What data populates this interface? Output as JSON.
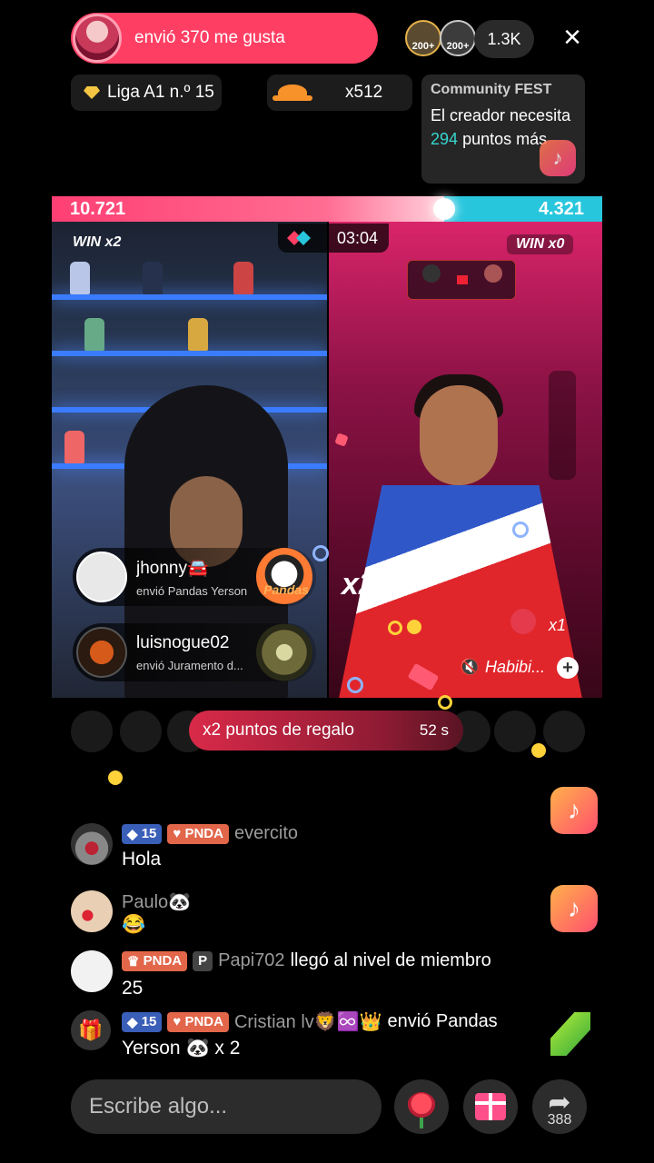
{
  "top": {
    "like_banner": "envió 370 me gusta",
    "viewer_badges": [
      "200+",
      "200+"
    ],
    "viewer_count": "1.3K",
    "close_icon": "×"
  },
  "chips": {
    "league": "Liga A1 n.º 15",
    "hat_count": "x512"
  },
  "community": {
    "title": "Community FEST",
    "line_before": "El creador necesita",
    "points": "294",
    "line_after": "puntos más"
  },
  "battle": {
    "left_score": "10.721",
    "right_score": "4.321",
    "left_share": 0.713,
    "win_left": "WIN x2",
    "win_right": "WIN x0",
    "timer": "03:04",
    "multiplier_big": "x2",
    "rose_multiplier": "x1",
    "music": "Habibi..."
  },
  "gifts": [
    {
      "user": "jhonny🚘",
      "desc": "envió Pandas Yerson",
      "gift_name": "Pandas"
    },
    {
      "user": "luisnogue02",
      "desc": "envió Juramento d..."
    }
  ],
  "bonus": {
    "label": "x2 puntos de regalo",
    "time": "52 s"
  },
  "chat": [
    {
      "level": "15",
      "badge": "PNDA",
      "name": "evercito",
      "message": "Hola"
    },
    {
      "name": "Paulo🐼",
      "message": "😂"
    },
    {
      "badge": "PNDA",
      "name": "Papi702",
      "event": "llegó al nivel de miembro",
      "value": "25"
    },
    {
      "level": "15",
      "badge": "PNDA",
      "name": "Cristian lv🦁♾️👑",
      "event": "envió Pandas",
      "line2": "Yerson 🐼 x 2"
    }
  ],
  "bottom": {
    "input_placeholder": "Escribe algo...",
    "share_count": "388"
  },
  "colors": {
    "accent_pink": "#ff3e63",
    "battle_blue": "#28c6dd",
    "points_teal": "#37d6d0"
  }
}
